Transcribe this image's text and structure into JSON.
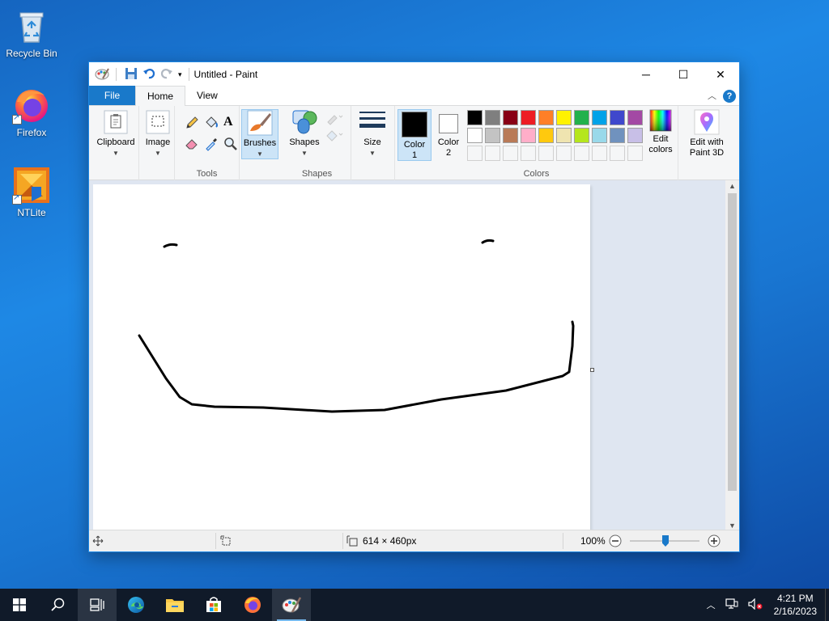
{
  "desktop": {
    "icons": [
      {
        "label": "Recycle Bin"
      },
      {
        "label": "Firefox"
      },
      {
        "label": "NTLite"
      }
    ]
  },
  "window": {
    "title": "Untitled - Paint",
    "controls": {
      "minimize": "─",
      "maximize": "☐",
      "close": "✕"
    }
  },
  "ribbon": {
    "tabs": [
      {
        "label": "File"
      },
      {
        "label": "Home"
      },
      {
        "label": "View"
      }
    ],
    "help": "?",
    "groups": {
      "clipboard": {
        "label": "Clipboard"
      },
      "image": {
        "label": "Image"
      },
      "tools": {
        "label": "Tools"
      },
      "brushes": {
        "label": "Brushes"
      },
      "shapes": {
        "button": "Shapes",
        "label": "Shapes"
      },
      "size": {
        "label": "Size"
      },
      "color1": {
        "line1": "Color",
        "line2": "1"
      },
      "color2": {
        "line1": "Color",
        "line2": "2"
      },
      "colors": {
        "label": "Colors"
      },
      "edit_colors": {
        "line1": "Edit",
        "line2": "colors"
      },
      "paint3d": {
        "line1": "Edit with",
        "line2": "Paint 3D"
      }
    },
    "palette_row1": [
      "#000000",
      "#7f7f7f",
      "#880015",
      "#ed1c24",
      "#ff7f27",
      "#fff200",
      "#22b14c",
      "#00a2e8",
      "#3f48cc",
      "#a349a4"
    ],
    "palette_row2": [
      "#ffffff",
      "#c3c3c3",
      "#b97a57",
      "#ffaec9",
      "#ffc90e",
      "#efe4b0",
      "#b5e61d",
      "#99d9ea",
      "#7092be",
      "#c8bfe7"
    ],
    "color1_value": "#000000",
    "color2_value": "#ffffff"
  },
  "statusbar": {
    "dimensions": "614 × 460px",
    "zoom": "100%"
  },
  "taskbar": {
    "time": "4:21 PM",
    "date": "2/16/2023"
  }
}
